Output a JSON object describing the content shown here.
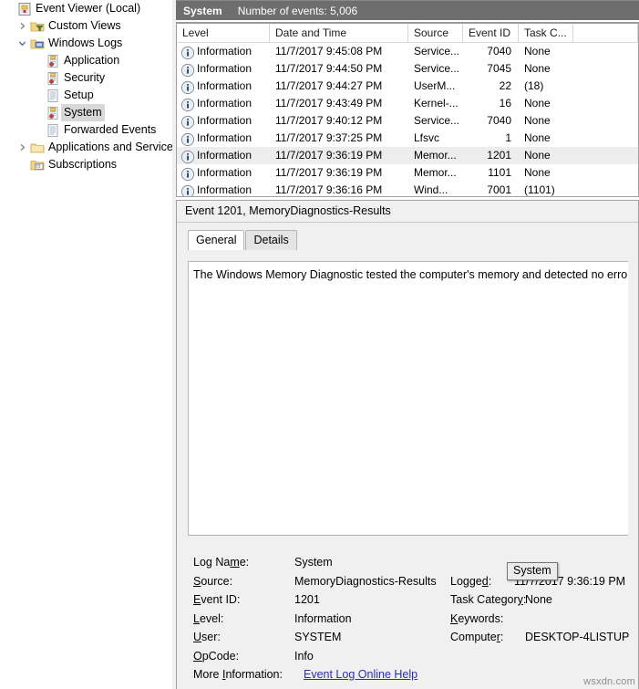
{
  "tree": {
    "items": [
      {
        "label": "Event Viewer (Local)",
        "icon": "event-viewer-icon",
        "indent": 1,
        "twisty": "none",
        "selected": false
      },
      {
        "label": "Custom Views",
        "icon": "folder-filter-icon",
        "indent": 2,
        "twisty": "collapsed",
        "selected": false
      },
      {
        "label": "Windows Logs",
        "icon": "folder-computer-icon",
        "indent": 2,
        "twisty": "expanded",
        "selected": false
      },
      {
        "label": "Application",
        "icon": "log-secured-icon",
        "indent": 3,
        "twisty": "none",
        "selected": false
      },
      {
        "label": "Security",
        "icon": "log-secured-icon",
        "indent": 3,
        "twisty": "none",
        "selected": false
      },
      {
        "label": "Setup",
        "icon": "log-icon",
        "indent": 3,
        "twisty": "none",
        "selected": false
      },
      {
        "label": "System",
        "icon": "log-secured-icon",
        "indent": 3,
        "twisty": "none",
        "selected": true
      },
      {
        "label": "Forwarded Events",
        "icon": "log-icon",
        "indent": 3,
        "twisty": "none",
        "selected": false
      },
      {
        "label": "Applications and Services Lo",
        "icon": "folder-icon",
        "indent": 2,
        "twisty": "collapsed",
        "selected": false
      },
      {
        "label": "Subscriptions",
        "icon": "subscriptions-icon",
        "indent": 2,
        "twisty": "none",
        "selected": false
      }
    ]
  },
  "list_header": {
    "log_name": "System",
    "count_text": "Number of events: 5,006"
  },
  "events": {
    "columns": [
      "Level",
      "Date and Time",
      "Source",
      "Event ID",
      "Task C..."
    ],
    "rows": [
      {
        "level": "Information",
        "date": "11/7/2017 9:45:08 PM",
        "source": "Service...",
        "event_id": "7040",
        "task": "None",
        "selected": false
      },
      {
        "level": "Information",
        "date": "11/7/2017 9:44:50 PM",
        "source": "Service...",
        "event_id": "7045",
        "task": "None",
        "selected": false
      },
      {
        "level": "Information",
        "date": "11/7/2017 9:44:27 PM",
        "source": "UserM...",
        "event_id": "22",
        "task": "(18)",
        "selected": false
      },
      {
        "level": "Information",
        "date": "11/7/2017 9:43:49 PM",
        "source": "Kernel-...",
        "event_id": "16",
        "task": "None",
        "selected": false
      },
      {
        "level": "Information",
        "date": "11/7/2017 9:40:12 PM",
        "source": "Service...",
        "event_id": "7040",
        "task": "None",
        "selected": false
      },
      {
        "level": "Information",
        "date": "11/7/2017 9:37:25 PM",
        "source": "Lfsvc",
        "event_id": "1",
        "task": "None",
        "selected": false
      },
      {
        "level": "Information",
        "date": "11/7/2017 9:36:19 PM",
        "source": "Memor...",
        "event_id": "1201",
        "task": "None",
        "selected": true
      },
      {
        "level": "Information",
        "date": "11/7/2017 9:36:19 PM",
        "source": "Memor...",
        "event_id": "1101",
        "task": "None",
        "selected": false
      },
      {
        "level": "Information",
        "date": "11/7/2017 9:36:16 PM",
        "source": "Wind...",
        "event_id": "7001",
        "task": "(1101)",
        "selected": false
      }
    ]
  },
  "detail": {
    "title": "Event 1201, MemoryDiagnostics-Results",
    "tabs": [
      {
        "label": "General",
        "active": true
      },
      {
        "label": "Details",
        "active": false
      }
    ],
    "description": "The Windows Memory Diagnostic tested the computer's memory and detected no errors"
  },
  "metadata": {
    "log_name_label": "Log Name:",
    "log_name_value": "System",
    "source_label": "Source:",
    "source_value": "MemoryDiagnostics-Results",
    "logged_label": "Logged:",
    "logged_value": "11/7/2017 9:36:19 PM",
    "event_id_label": "Event ID:",
    "event_id_value": "1201",
    "task_category_label": "Task Category:",
    "task_category_value": "None",
    "level_label": "Level:",
    "level_value": "Information",
    "keywords_label": "Keywords:",
    "keywords_value": "",
    "user_label": "User:",
    "user_value": "SYSTEM",
    "computer_label": "Computer:",
    "computer_value": "DESKTOP-4LISTUP",
    "opcode_label": "OpCode:",
    "opcode_value": "Info",
    "more_info_label": "More Information:",
    "more_info_link": "Event Log Online Help"
  },
  "tooltip": {
    "text": "System"
  },
  "watermark": {
    "text": "wsxdn.com"
  },
  "colors": {
    "title_bar": "#6e6e6e",
    "selection": "#ededed",
    "tree_selection": "#d8d8d8",
    "link": "#2b2bc0",
    "pane_bg": "#f0f0f0"
  }
}
